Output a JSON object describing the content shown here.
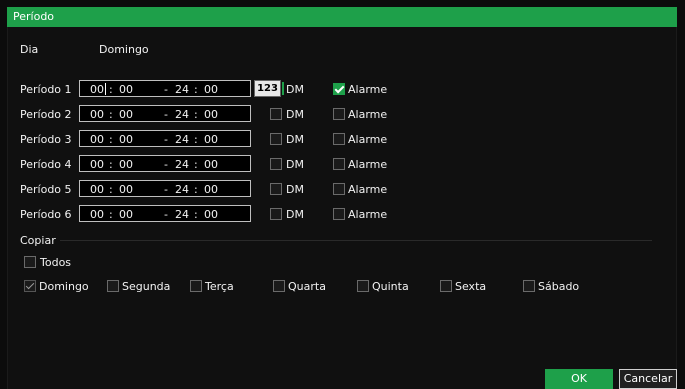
{
  "window": {
    "title": "Período"
  },
  "day": {
    "label": "Dia",
    "value": "Domingo"
  },
  "periods": [
    {
      "label": "Período 1",
      "start_h": "00",
      "start_m": "00",
      "sep": "-",
      "end_h": "24",
      "end_m": "00",
      "dm_label": "DM",
      "dm_checked": false,
      "alarm_label": "Alarme",
      "alarm_checked": true
    },
    {
      "label": "Período 2",
      "start_h": "00",
      "start_m": "00",
      "sep": "-",
      "end_h": "24",
      "end_m": "00",
      "dm_label": "DM",
      "dm_checked": false,
      "alarm_label": "Alarme",
      "alarm_checked": false
    },
    {
      "label": "Período 3",
      "start_h": "00",
      "start_m": "00",
      "sep": "-",
      "end_h": "24",
      "end_m": "00",
      "dm_label": "DM",
      "dm_checked": false,
      "alarm_label": "Alarme",
      "alarm_checked": false
    },
    {
      "label": "Período 4",
      "start_h": "00",
      "start_m": "00",
      "sep": "-",
      "end_h": "24",
      "end_m": "00",
      "dm_label": "DM",
      "dm_checked": false,
      "alarm_label": "Alarme",
      "alarm_checked": false
    },
    {
      "label": "Período 5",
      "start_h": "00",
      "start_m": "00",
      "sep": "-",
      "end_h": "24",
      "end_m": "00",
      "dm_label": "DM",
      "dm_checked": false,
      "alarm_label": "Alarme",
      "alarm_checked": false
    },
    {
      "label": "Período 6",
      "start_h": "00",
      "start_m": "00",
      "sep": "-",
      "end_h": "24",
      "end_m": "00",
      "dm_label": "DM",
      "dm_checked": false,
      "alarm_label": "Alarme",
      "alarm_checked": false
    }
  ],
  "input_mode_badge": "123",
  "copy": {
    "section_label": "Copiar",
    "all_label": "Todos",
    "days": [
      "Domingo",
      "Segunda",
      "Terça",
      "Quarta",
      "Quinta",
      "Sexta",
      "Sábado"
    ],
    "days_checked": [
      true,
      false,
      false,
      false,
      false,
      false,
      false
    ]
  },
  "buttons": {
    "ok": "OK",
    "cancel": "Cancelar"
  },
  "colors": {
    "accent": "#1ea04a",
    "background": "#101010",
    "text": "#f2f2f2"
  }
}
